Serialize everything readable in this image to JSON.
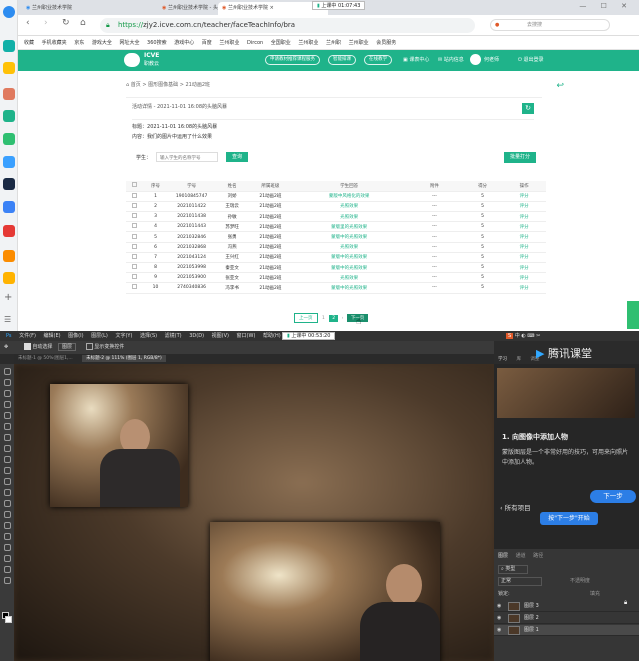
{
  "browser": {
    "tabs": [
      "兰州职业技术学院",
      "兰州职业技术学院 - 头脑风暴详",
      "兰州职业技术学院"
    ],
    "url_host": "https://",
    "url_rest": "zjy2.icve.com.cn/teacher/faceTeachInfo/bra",
    "timer_top": "上课中 01:07:43",
    "bookmarks": [
      "收藏",
      "手机收藏夹",
      "京东",
      "游戏大全",
      "网址大全",
      "360搜索",
      "游戏中心",
      "百度",
      "兰州职业",
      "Dircon",
      "全国职业",
      "兰州职业",
      "兰州职",
      "兰州职业",
      "会员服务"
    ],
    "search_text": "去搜搜"
  },
  "site": {
    "logo_name": "ICVE",
    "logo_sub": "职教云",
    "header_buttons": [
      "申请教材推荐课程服务",
      "智能排课",
      "在线教学"
    ],
    "nav_items": [
      "课表中心",
      "站内信息",
      "何老师",
      "退出登录"
    ],
    "breadcrumb": "首页 > 图形图像基础 > 21动画2班",
    "activity": {
      "crumb": "活动详情 - 2021-11-01 16:08的头脑风暴",
      "title_label": "标题：",
      "title_value": "2021-11-01 16:08的头脑风暴",
      "content_label": "内容：",
      "content_value": "我们的图片中运用了什么效果"
    },
    "search": {
      "label": "学生：",
      "placeholder": "输入学生的名称学号",
      "button": "查询"
    },
    "batch_button": "批量打分",
    "table": {
      "headers": [
        "",
        "序号",
        "学号",
        "姓名",
        "所属班级",
        "学生回答",
        "附件",
        "得分",
        "操作"
      ],
      "rows": [
        [
          "1",
          "19010845747",
          "刘娇",
          "21动画2班",
          "蒙版中风格化的效果",
          "---",
          "5",
          "评分"
        ],
        [
          "2",
          "2021011422",
          "王瑞云",
          "21动画2班",
          "光照效果",
          "---",
          "5",
          "评分"
        ],
        [
          "3",
          "2021011438",
          "孙敏",
          "21动画2班",
          "光照效果",
          "---",
          "5",
          "评分"
        ],
        [
          "4",
          "2021011443",
          "苏梦旺",
          "21动画2班",
          "蒙版里的光照效果",
          "---",
          "5",
          "评分"
        ],
        [
          "5",
          "2021032846",
          "张勇",
          "21动画2班",
          "蒙版中的光照效果",
          "---",
          "5",
          "评分"
        ],
        [
          "6",
          "2021032868",
          "冯燕",
          "21动画2班",
          "光照效果",
          "---",
          "5",
          "评分"
        ],
        [
          "7",
          "2021043124",
          "王兴红",
          "21动画2班",
          "蒙版中的光照效果",
          "---",
          "5",
          "评分"
        ],
        [
          "8",
          "2021053998",
          "秦亚文",
          "21动画2班",
          "蒙版中的光照效果",
          "---",
          "5",
          "评分"
        ],
        [
          "9",
          "2021053900",
          "张亚文",
          "21动画2班",
          "光照效果",
          "---",
          "5",
          "评分"
        ],
        [
          "10",
          "2740340836",
          "冯李书",
          "21动画2班",
          "蒙版中的光照效果",
          "---",
          "5",
          "评分"
        ]
      ]
    },
    "pagination": {
      "prev": "上一页",
      "pages": [
        "1",
        "2"
      ],
      "next": "下一页"
    }
  },
  "photoshop": {
    "menu": [
      "文件(F)",
      "编辑(E)",
      "图像(I)",
      "图层(L)",
      "文字(Y)",
      "选择(S)",
      "滤镜(T)",
      "3D(D)",
      "视图(V)",
      "窗口(W)",
      "帮助(H)"
    ],
    "timer_bottom": "上课中 00:53:20",
    "options": [
      "自动选择",
      "图层",
      "显示变换控件"
    ],
    "doc_tabs": [
      "未标题-1 @ 50%(图层1,...",
      "未标题-2 @ 111% (图层 1, RGB/8*)"
    ],
    "panel_tabs": [
      "学习",
      "库",
      "调整"
    ],
    "tutorial": {
      "brand": "腾讯课堂",
      "step_title": "1. 向图像中添加人物",
      "step_text": "蒙版图层是一个非常好用的技巧，可用来向照片中添加人物。",
      "back": "所有项目",
      "tip": "按\"下一步\"开始",
      "next": "下一步"
    },
    "layers": {
      "tabs": [
        "图层",
        "通道",
        "路径"
      ],
      "filter": "类型",
      "mode": "正常",
      "opacity": "不透明度",
      "fill": "填充",
      "lock": "锁定:",
      "items": [
        "图层 3",
        "图层 2",
        "图层 1"
      ]
    }
  }
}
